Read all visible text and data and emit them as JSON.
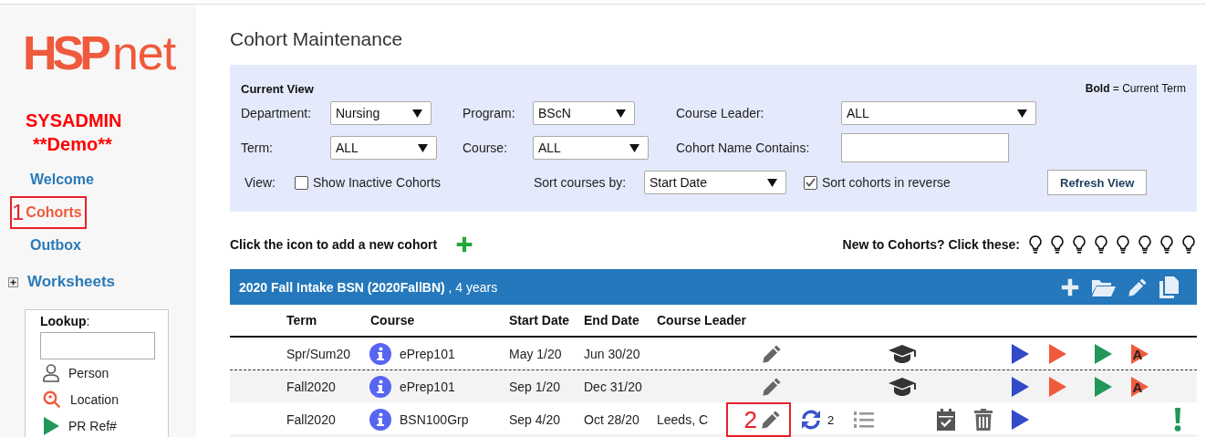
{
  "sidebar": {
    "logo": "**HSP**net",
    "user": "SYSADMIN",
    "site": "**Demo**",
    "nav": [
      {
        "label": "Welcome",
        "selected": false
      },
      {
        "label": "Cohorts",
        "selected": true,
        "annotation": "1"
      },
      {
        "label": "Outbox",
        "selected": false
      },
      {
        "label": "Worksheets",
        "selected": false,
        "kind": "group",
        "expanded": false
      }
    ],
    "lookup": {
      "label": "**Lookup**:",
      "items": [
        {
          "label": "Person",
          "kind": "person"
        },
        {
          "label": "Location",
          "kind": "location"
        },
        {
          "label": "PR Ref#",
          "kind": "play"
        }
      ]
    }
  },
  "page_title": "Cohort Maintenance",
  "filter_panel": {
    "title": "Current View",
    "legend": "**Bold** = Current Term",
    "fields": [
      {
        "kind": "select",
        "label": "Department:",
        "value": "Nursing"
      },
      {
        "kind": "select",
        "label": "Program:",
        "value": "BScN"
      },
      {
        "kind": "select",
        "label": "Course Leader:",
        "value": "ALL"
      },
      {
        "kind": "select",
        "label": "Term:",
        "value": "ALL"
      },
      {
        "kind": "select",
        "label": "Course:",
        "value": "ALL"
      },
      {
        "kind": "text",
        "label": "Cohort Name Contains:"
      }
    ],
    "view_row": [
      {
        "kind": "label",
        "text": "View:"
      },
      {
        "kind": "checkbox",
        "text": "Show Inactive Cohorts",
        "checked": false
      },
      {
        "kind": "label",
        "text": "Sort courses by:"
      },
      {
        "kind": "select",
        "text": "Start Date"
      },
      {
        "kind": "checkbox",
        "text": "Sort cohorts in reverse",
        "checked": true
      },
      {
        "kind": "button",
        "text": "Refresh View"
      }
    ]
  },
  "add_hint": "Click the icon to add a new cohort",
  "tips_hint": "New to Cohorts? Click these:",
  "cohort": {
    "title": "**2020 Fall Intake BSN (2020FallBN)** , 4 years",
    "columns": [
      "Term",
      "Course",
      "Start Date",
      "End Date",
      "Course Leader"
    ],
    "rows": [
      {
        "term": "Spr/Sum20",
        "course": "ePrep101",
        "start": "May 1/20",
        "end": "Jun 30/20",
        "actions": [
          {
            "kind": "edit"
          },
          {
            "kind": "graduate"
          },
          {
            "kind": "play",
            "color": "#3249c8"
          },
          {
            "kind": "play",
            "color": "#f05a3c"
          },
          {
            "kind": "play",
            "color": "#22975a"
          },
          {
            "kind": "play",
            "color": "#f05a3c",
            "letter": "A"
          }
        ]
      },
      {
        "term": "Fall2020",
        "course": "ePrep101",
        "start": "Sep 1/20",
        "end": "Dec 31/20",
        "actions": [
          {
            "kind": "edit"
          },
          {
            "kind": "graduate"
          },
          {
            "kind": "play",
            "color": "#3249c8"
          },
          {
            "kind": "play",
            "color": "#f05a3c"
          },
          {
            "kind": "play",
            "color": "#22975a"
          },
          {
            "kind": "play",
            "color": "#f05a3c",
            "letter": "A"
          }
        ]
      },
      {
        "term": "Fall2020",
        "course": "BSN100Grp",
        "start": "Sep 4/20",
        "end": "Oct 28/20",
        "leader": "Leeds, C",
        "actions": [
          {
            "kind": "edit",
            "annotation": "2"
          },
          {
            "kind": "sync",
            "count": "2"
          },
          {
            "kind": "list"
          },
          {
            "kind": "calendar"
          },
          {
            "kind": "delete"
          },
          {
            "kind": "play",
            "color": "#3249c8"
          },
          {
            "kind": "alert"
          }
        ]
      }
    ]
  }
}
